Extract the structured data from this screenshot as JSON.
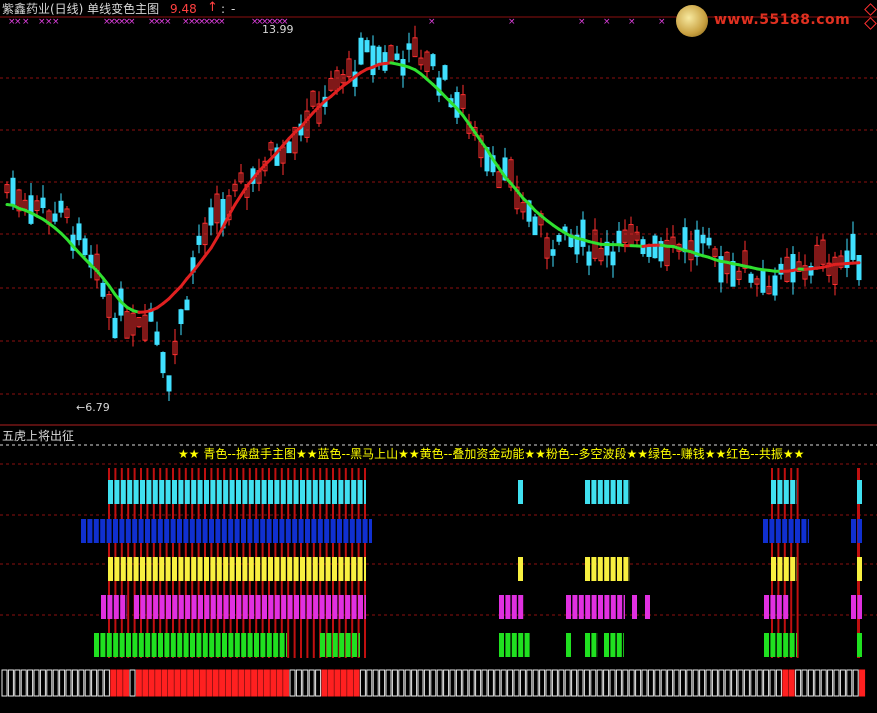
{
  "header": {
    "title": "紫鑫药业(日线) 单线变色主图",
    "price": "9.48",
    "arrow": "↑",
    "colon": ":",
    "dash": "-"
  },
  "annotations": {
    "high": "13.99",
    "low": "←6.79"
  },
  "logo": {
    "text": "www.55188.com"
  },
  "sub_panel": {
    "title": "五虎上将出征",
    "legend": "★★ 青色--操盘手主图★★蓝色--黑马上山★★黄色--叠加资金动能★★粉色--多空波段★★绿色--赚钱★★红色--共振★★"
  },
  "colors": {
    "up": "#ff3030",
    "down": "#40e0ff",
    "line_up": "#e02020",
    "line_down": "#30e030",
    "grid": "#8b1010",
    "cyan": "#40e0f0",
    "blue": "#1030d0",
    "yellow": "#f8f040",
    "pink": "#e030e0",
    "green": "#20e020",
    "red": "#ff2020",
    "marker": "#e040e0"
  },
  "chart_data": {
    "type": "candlestick",
    "price_high": 13.99,
    "price_low": 6.79,
    "current_price": 9.48,
    "indicator_rows": [
      "青色",
      "蓝色",
      "黄色",
      "粉色",
      "绿色",
      "红色"
    ]
  }
}
